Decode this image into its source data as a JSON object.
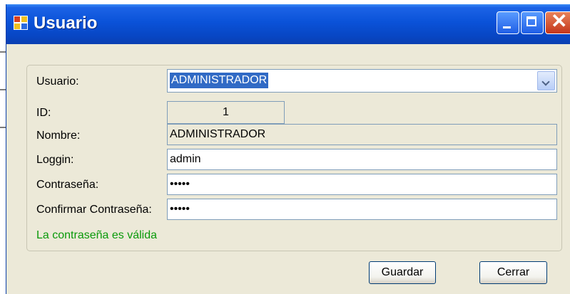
{
  "window": {
    "title": "Usuario"
  },
  "form": {
    "usuario_label": "Usuario:",
    "usuario_value": "ADMINISTRADOR",
    "id_label": "ID:",
    "id_value": "1",
    "nombre_label": "Nombre:",
    "nombre_value": "ADMINISTRADOR",
    "loggin_label": "Loggin:",
    "loggin_value": "admin",
    "password_label": "Contraseña:",
    "password_value": "•••••",
    "confirm_label": "Confirmar Contraseña:",
    "confirm_value": "•••••",
    "validation_message": "La contraseña es válida"
  },
  "buttons": {
    "save_label": "Guardar",
    "close_label": "Cerrar"
  },
  "colors": {
    "titlebar": "#0a52d8",
    "client": "#ece9d8",
    "selection": "#316ac5",
    "valid_text": "#0a9a0a"
  },
  "icons": [
    "app-icon",
    "minimize-icon",
    "maximize-icon",
    "close-icon",
    "chevron-down-icon"
  ]
}
